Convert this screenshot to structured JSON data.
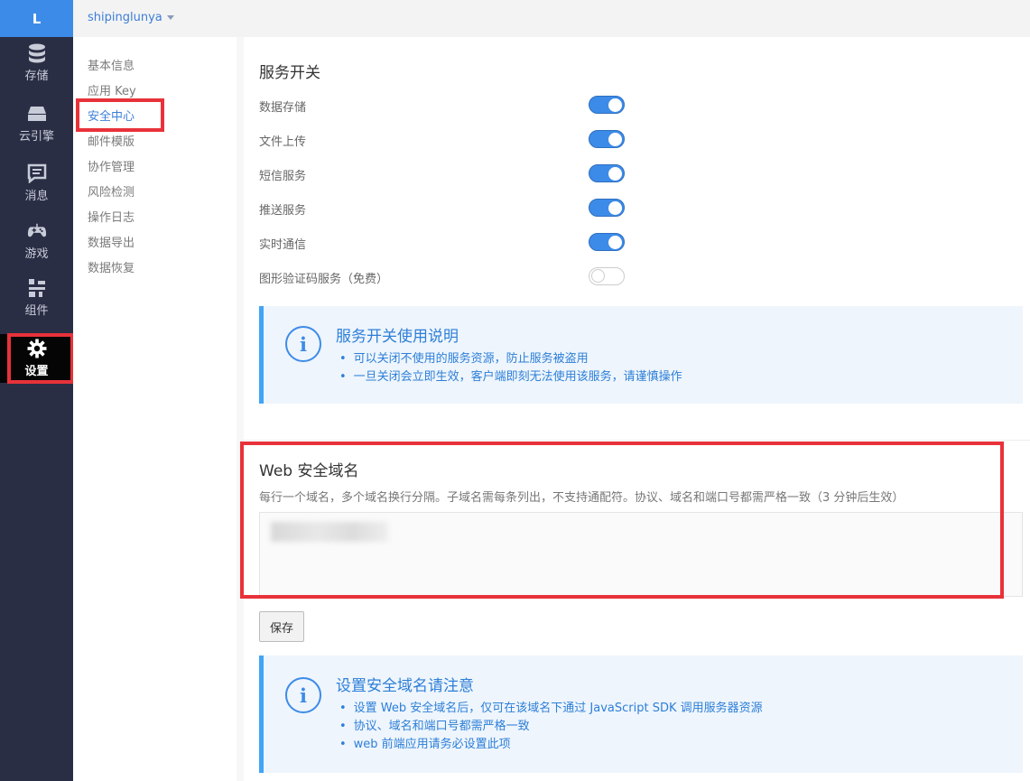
{
  "logo": "L",
  "app_name": "shipinglunya",
  "nav": [
    {
      "label": "存储",
      "icon": "database-icon"
    },
    {
      "label": "云引擎",
      "icon": "server-icon"
    },
    {
      "label": "消息",
      "icon": "message-icon"
    },
    {
      "label": "游戏",
      "icon": "gamepad-icon"
    },
    {
      "label": "组件",
      "icon": "component-icon"
    },
    {
      "label": "设置",
      "icon": "gear-icon",
      "active": true
    }
  ],
  "submenu": [
    "基本信息",
    "应用 Key",
    "安全中心",
    "邮件模版",
    "协作管理",
    "风险检测",
    "操作日志",
    "数据导出",
    "数据恢复"
  ],
  "services": {
    "title": "服务开关",
    "toggles": [
      {
        "label": "数据存储",
        "on": true
      },
      {
        "label": "文件上传",
        "on": true
      },
      {
        "label": "短信服务",
        "on": true
      },
      {
        "label": "推送服务",
        "on": true
      },
      {
        "label": "实时通信",
        "on": true
      },
      {
        "label": "图形验证码服务（免费）",
        "on": false
      }
    ]
  },
  "services_info": {
    "icon_glyph": "i",
    "title": "服务开关使用说明",
    "items": [
      "可以关闭不使用的服务资源，防止服务被盗用",
      "一旦关闭会立即生效，客户端即刻无法使用该服务，请谨慎操作"
    ]
  },
  "domains": {
    "title": "Web 安全域名",
    "description": "每行一个域名，多个域名换行分隔。子域名需每条列出，不支持通配符。协议、域名和端口号都需严格一致（3 分钟后生效）",
    "save_label": "保存"
  },
  "domains_info": {
    "icon_glyph": "i",
    "title": "设置安全域名请注意",
    "items": [
      "设置 Web 安全域名后，仅可在该域名下通过 JavaScript SDK 调用服务器资源",
      "协议、域名和端口号都需严格一致",
      "web 前端应用请务必设置此项"
    ]
  },
  "colors": {
    "accent": "#3d8be8",
    "highlight": "#e8323a",
    "sidebar": "#2a2e45"
  }
}
